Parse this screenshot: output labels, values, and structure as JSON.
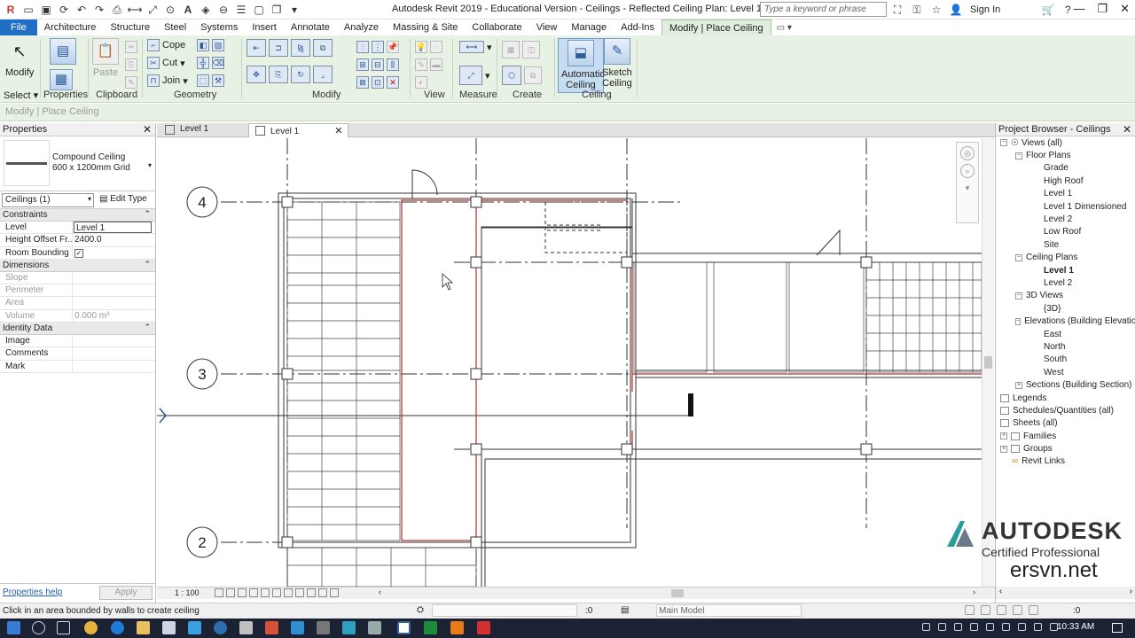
{
  "titlebar": {
    "title": "Autodesk Revit 2019 - Educational Version - Ceilings - Reflected Ceiling Plan: Level 1",
    "search_placeholder": "Type a keyword or phrase",
    "sign_in": "Sign In"
  },
  "tabs": [
    {
      "label": "File"
    },
    {
      "label": "Architecture"
    },
    {
      "label": "Structure"
    },
    {
      "label": "Steel"
    },
    {
      "label": "Systems"
    },
    {
      "label": "Insert"
    },
    {
      "label": "Annotate"
    },
    {
      "label": "Analyze"
    },
    {
      "label": "Massing & Site"
    },
    {
      "label": "Collaborate"
    },
    {
      "label": "View"
    },
    {
      "label": "Manage"
    },
    {
      "label": "Add-Ins"
    },
    {
      "label": "Modify | Place Ceiling"
    }
  ],
  "ribbon": {
    "modify": "Modify",
    "select": "Select",
    "properties": "Properties",
    "paste": "Paste",
    "clipboard": "Clipboard",
    "cope": "Cope",
    "cut": "Cut",
    "join": "Join",
    "geometry": "Geometry",
    "modify_panel": "Modify",
    "view_panel": "View",
    "measure_panel": "Measure",
    "create_panel": "Create",
    "automatic_ceiling": "Automatic Ceiling",
    "sketch_ceiling": "Sketch Ceiling",
    "ceiling_panel": "Ceiling"
  },
  "context_bar": "Modify | Place Ceiling",
  "properties": {
    "title": "Properties",
    "type_line1": "Compound Ceiling",
    "type_line2": "600 x 1200mm Grid",
    "instance_filter": "Ceilings (1)",
    "edit_type": "Edit Type",
    "groups": {
      "constraints": "Constraints",
      "dimensions": "Dimensions",
      "identity": "Identity Data"
    },
    "rows": {
      "level_k": "Level",
      "level_v": "Level 1",
      "height_k": "Height Offset Fr...",
      "height_v": "2400.0",
      "room_k": "Room Bounding",
      "slope_k": "Slope",
      "perimeter_k": "Perimeter",
      "area_k": "Area",
      "volume_k": "Volume",
      "volume_v": "0.000 m³",
      "image_k": "Image",
      "comments_k": "Comments",
      "mark_k": "Mark"
    },
    "help": "Properties help",
    "apply": "Apply"
  },
  "view_tabs": {
    "tab1": "Level 1",
    "tab2": "Level 1"
  },
  "grid_labels": {
    "g4": "4",
    "g3": "3",
    "g2": "2"
  },
  "view_control": {
    "scale": "1 : 100"
  },
  "browser": {
    "title": "Project Browser - Ceilings",
    "nodes": [
      {
        "label": "Views (all)"
      },
      {
        "label": "Floor Plans"
      },
      {
        "label": "Grade"
      },
      {
        "label": "High Roof"
      },
      {
        "label": "Level 1"
      },
      {
        "label": "Level 1 Dimensioned"
      },
      {
        "label": "Level 2"
      },
      {
        "label": "Low Roof"
      },
      {
        "label": "Site"
      },
      {
        "label": "Ceiling Plans"
      },
      {
        "label": "Level 1"
      },
      {
        "label": "Level 2"
      },
      {
        "label": "3D Views"
      },
      {
        "label": "{3D}"
      },
      {
        "label": "Elevations (Building Elevation)"
      },
      {
        "label": "East"
      },
      {
        "label": "North"
      },
      {
        "label": "South"
      },
      {
        "label": "West"
      },
      {
        "label": "Sections (Building Section)"
      },
      {
        "label": "Legends"
      },
      {
        "label": "Schedules/Quantities (all)"
      },
      {
        "label": "Sheets (all)"
      },
      {
        "label": "Families"
      },
      {
        "label": "Groups"
      },
      {
        "label": "Revit Links"
      }
    ]
  },
  "watermark": {
    "brand": "AUTODESK",
    "sub": "Certified Professional",
    "site": "ersvn.net"
  },
  "status": {
    "message": "Click in an area bounded by walls to create ceiling",
    "zero": ":0",
    "model": "Main Model",
    "filter": ":0"
  },
  "taskbar": {
    "time": "10:33 AM"
  }
}
